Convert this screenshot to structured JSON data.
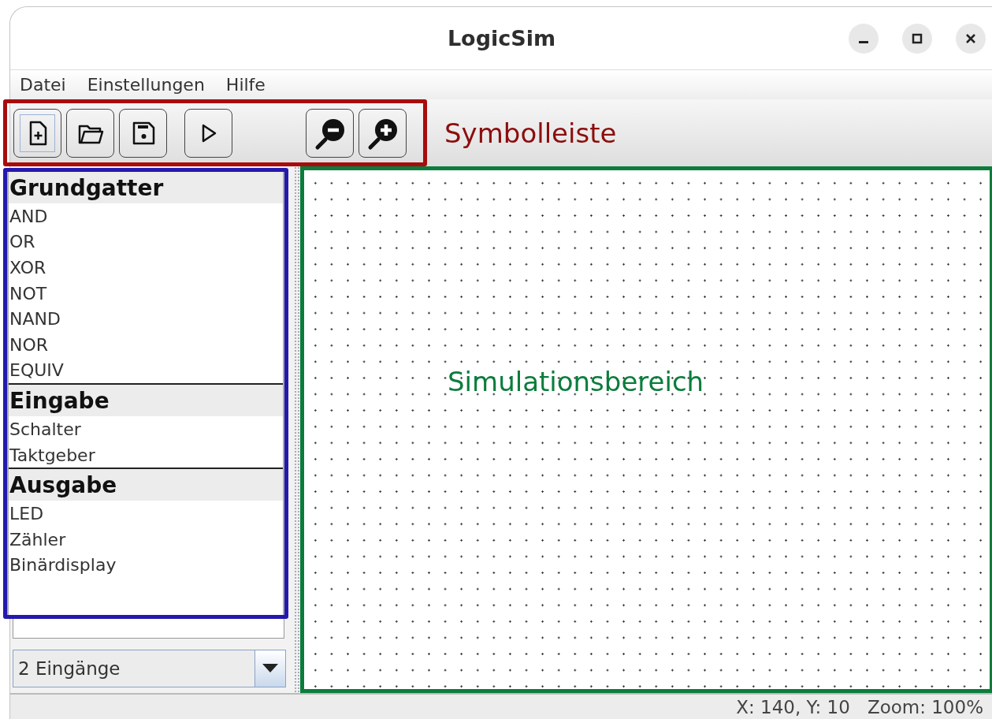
{
  "window": {
    "title": "LogicSim"
  },
  "menu": [
    "Datei",
    "Einstellungen",
    "Hilfe"
  ],
  "toolbar": {
    "groups": [
      [
        {
          "kind": "new",
          "focused": true
        },
        {
          "kind": "open",
          "focused": false
        },
        {
          "kind": "save",
          "focused": false
        }
      ],
      [
        {
          "kind": "run",
          "focused": false
        }
      ],
      [
        {
          "kind": "zoom-out",
          "focused": false
        },
        {
          "kind": "zoom-in",
          "focused": false
        }
      ]
    ],
    "annotation": "Symbolleiste"
  },
  "palette": {
    "groups": [
      {
        "title": "Grundgatter",
        "items": [
          "AND",
          "OR",
          "XOR",
          "NOT",
          "NAND",
          "NOR",
          "EQUIV"
        ]
      },
      {
        "title": "Eingabe",
        "items": [
          "Schalter",
          "Taktgeber"
        ]
      },
      {
        "title": "Ausgabe",
        "items": [
          "LED",
          "Zähler",
          "Binärdisplay"
        ]
      }
    ]
  },
  "gate_inputs": {
    "value": "2 Eingänge"
  },
  "canvas": {
    "annotation": "Simulationsbereich"
  },
  "status_bar": {
    "position": "X: 140, Y: 10",
    "zoom": "Zoom: 100%"
  }
}
